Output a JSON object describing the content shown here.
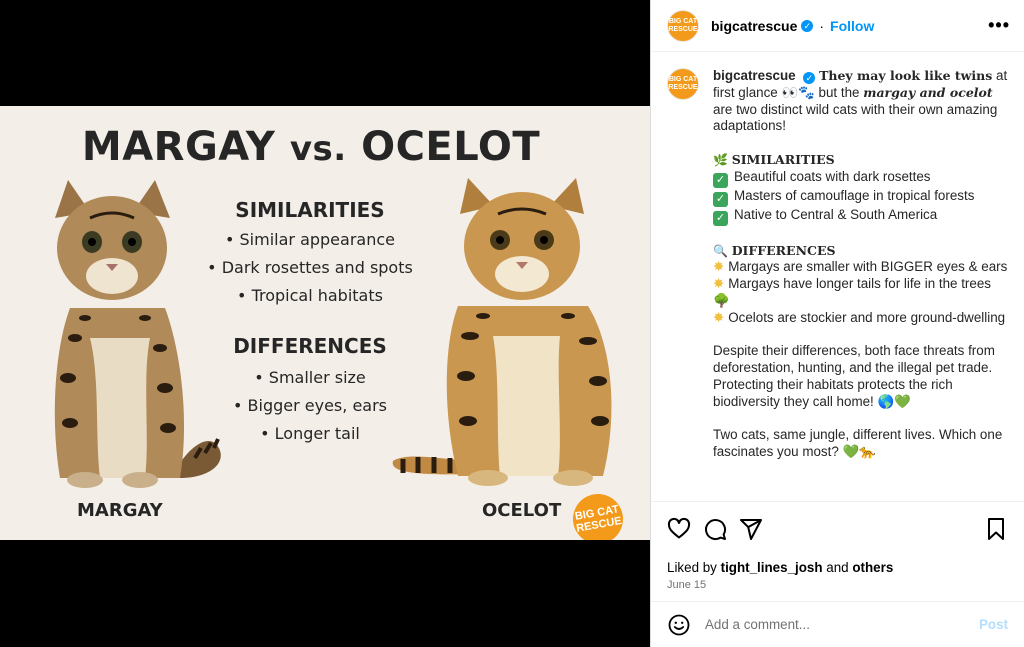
{
  "infographic": {
    "title_a": "MARGAY ",
    "title_vs": "vs.",
    "title_b": " OCELOT",
    "similarities_head": "SIMILARITIES",
    "similarities": [
      "Similar appearance",
      "Dark rosettes and spots",
      "Tropical habitats"
    ],
    "differences_head": "DIFFERENCES",
    "differences": [
      "Smaller size",
      "Bigger eyes, ears",
      "Longer tail"
    ],
    "label_left": "MARGAY",
    "label_right": "OCELOT",
    "logo_text": "BIG CAT RESCUE"
  },
  "header": {
    "username": "bigcatrescue",
    "follow": "Follow",
    "more": "•••",
    "avatar_text": "BIG CAT RESCUE"
  },
  "caption": {
    "username": "bigcatrescue",
    "intro_bold": "They may look like twins",
    "intro_1": " at first glance 👀🐾 but the ",
    "intro_italic": "margay and ocelot",
    "intro_2": " are two distinct wild cats with their own amazing adaptations!",
    "sim_emoji": "🌿",
    "sim_head": "SIMILARITIES",
    "sim_items": [
      "Beautiful coats with dark rosettes",
      "Masters of camouflage in tropical forests",
      "Native to Central & South America"
    ],
    "diff_emoji": "🔍",
    "diff_head": "DIFFERENCES",
    "diff_items": [
      "Margays are smaller with BIGGER eyes & ears",
      "Margays have longer tails for life in the trees 🌳",
      "Ocelots are stockier and more ground-dwelling"
    ],
    "para_1": "Despite their differences, both face threats from deforestation, hunting, and the illegal pet trade. Protecting their habitats protects the rich biodiversity they call home! 🌎💚",
    "para_2": "Two cats, same jungle, different lives. Which one fascinates you most? 💚🐆"
  },
  "engagement": {
    "liked_prefix": "Liked by ",
    "liked_user": "tight_lines_josh",
    "liked_mid": " and ",
    "liked_others": "others",
    "date": "June 15"
  },
  "comment": {
    "placeholder": "Add a comment...",
    "post": "Post"
  },
  "colors": {
    "accent": "#0095f6",
    "brand_orange": "#f39a1b",
    "post_disabled": "#b2dffc"
  }
}
